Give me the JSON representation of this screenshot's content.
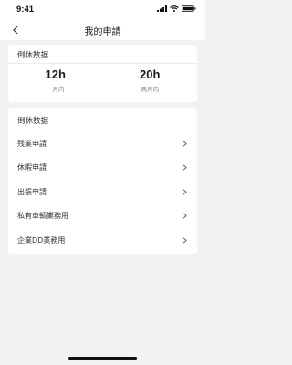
{
  "status": {
    "time": "9:41"
  },
  "nav": {
    "title": "我的申請"
  },
  "summary": {
    "header": "倒休数据",
    "stats": [
      {
        "value": "12h",
        "label": "一月内"
      },
      {
        "value": "20h",
        "label": "两月内"
      }
    ]
  },
  "list": {
    "header": "倒休数据",
    "items": [
      {
        "label": "残業申請"
      },
      {
        "label": "休暇申請"
      },
      {
        "label": "出張申請"
      },
      {
        "label": "私有車輌業務用"
      },
      {
        "label": "企業DD業務用"
      }
    ]
  }
}
